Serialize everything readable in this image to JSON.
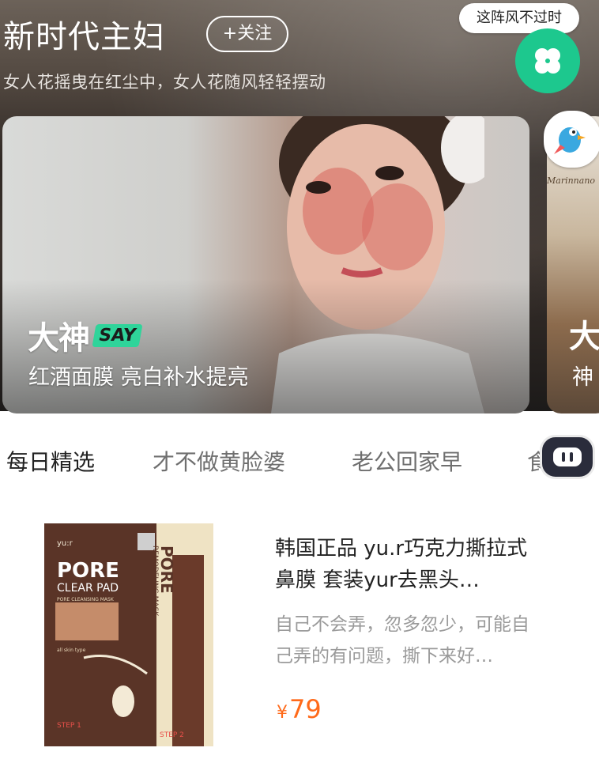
{
  "header": {
    "title": "新时代主妇",
    "follow_label": "+关注",
    "subtitle": "女人花摇曳在红尘中，女人花随风轻轻摆动",
    "tooltip": "这阵风不过时"
  },
  "featured": {
    "brand": "大神",
    "brand_tag": "SAY",
    "caption": "红酒面膜 亮白补水提亮",
    "next_brand": "大",
    "next_caption": "神",
    "next_sign": "Marinnano"
  },
  "tabs": [
    {
      "label": "每日精选",
      "active": true
    },
    {
      "label": "才不做黄脸婆",
      "active": false
    },
    {
      "label": "老公回家早",
      "active": false
    },
    {
      "label": "食",
      "active": false
    }
  ],
  "product": {
    "title": "韩国正品 yu.r巧克力撕拉式鼻膜 套装yur去黑头…",
    "description": "自己不会弄，忽多忽少，可能自己弄的有问题，撕下来好…",
    "currency": "¥",
    "price": "79",
    "package": {
      "brand": "yu:r",
      "name": "PORE",
      "line1": "CLEAR PAD",
      "line2": "PORE CLEANSING MASK",
      "side_name": "PORE",
      "side_line": "REMODELING MASK",
      "step1": "STEP 1",
      "step2": "STEP 2",
      "skin": "all skin type"
    }
  },
  "colors": {
    "accent_green": "#1dc88e",
    "price_orange": "#ff6a1a",
    "say_green": "#2fd49a"
  },
  "icons": [
    "clover-icon",
    "parrot-avatar-icon",
    "gamepad-icon"
  ]
}
